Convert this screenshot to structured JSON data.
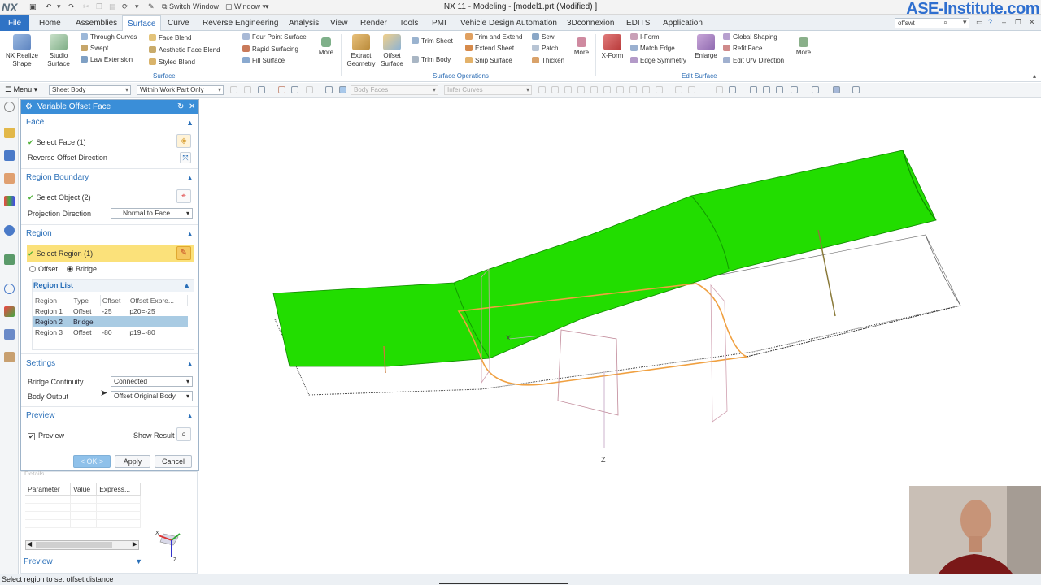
{
  "titlebar": {
    "logo": "NX",
    "switch_window": "Switch Window",
    "window_menu": "Window ▾",
    "title": "NX 11 - Modeling - [model1.prt (Modified) ]",
    "brand": "ASE-Institute.com"
  },
  "menubar": {
    "file": "File",
    "items": [
      "Home",
      "Assemblies",
      "Surface",
      "Curve",
      "Reverse Engineering",
      "Analysis",
      "View",
      "Render",
      "Tools",
      "PMI",
      "Vehicle Design Automation",
      "3Dconnexion",
      "EDITS",
      "Application"
    ],
    "active": "Surface",
    "search_value": "offswt"
  },
  "ribbon": {
    "nx_realize_shape": "NX Realize Shape",
    "studio_surface": "Studio Surface",
    "through_curves": "Through Curves",
    "swept": "Swept",
    "law_extension": "Law Extension",
    "face_blend": "Face Blend",
    "aesthetic_face_blend": "Aesthetic Face Blend",
    "styled_blend": "Styled Blend",
    "four_point_surface": "Four Point Surface",
    "rapid_surfacing": "Rapid Surfacing",
    "fill_surface": "Fill Surface",
    "more1": "More",
    "surface_group": "Surface",
    "extract_geometry": "Extract Geometry",
    "offset_surface": "Offset Surface",
    "trim_sheet": "Trim Sheet",
    "trim_body": "Trim Body",
    "trim_and_extend": "Trim and Extend",
    "extend_sheet": "Extend Sheet",
    "snip_surface": "Snip Surface",
    "sew": "Sew",
    "patch": "Patch",
    "thicken": "Thicken",
    "more2": "More",
    "surface_operations_group": "Surface Operations",
    "x_form": "X-Form",
    "i_form": "I-Form",
    "match_edge": "Match Edge",
    "edge_symmetry": "Edge Symmetry",
    "enlarge": "Enlarge",
    "global_shaping": "Global Shaping",
    "refit_face": "Refit Face",
    "edit_uv_direction": "Edit U/V Direction",
    "more3": "More",
    "edit_surface_group": "Edit Surface"
  },
  "selbar": {
    "menu": "Menu",
    "filter": "Sheet Body",
    "scope": "Within Work Part Only",
    "face_rule": "Body Faces",
    "curve_rule": "Infer Curves"
  },
  "dialog": {
    "title": "Variable Offset Face",
    "face": {
      "header": "Face",
      "select_face": "Select Face (1)",
      "reverse": "Reverse Offset Direction"
    },
    "region_boundary": {
      "header": "Region Boundary",
      "select_object": "Select Object (2)",
      "projection_label": "Projection Direction",
      "projection_value": "Normal to Face"
    },
    "region": {
      "header": "Region",
      "select_region": "Select Region (1)",
      "offset_option": "Offset",
      "bridge_option": "Bridge",
      "selected_option": "Bridge",
      "list_header": "Region List",
      "columns": [
        "Region",
        "Type",
        "Offset",
        "Offset Expre..."
      ],
      "rows": [
        [
          "Region 1",
          "Offset",
          "-25",
          "p20=-25"
        ],
        [
          "Region 2",
          "Bridge",
          "",
          ""
        ],
        [
          "Region 3",
          "Offset",
          "-80",
          "p19=-80"
        ]
      ],
      "selected_row": 1
    },
    "settings": {
      "header": "Settings",
      "bridge_continuity_label": "Bridge Continuity",
      "bridge_continuity_value": "Connected",
      "body_output_label": "Body Output",
      "body_output_value": "Offset Original Body"
    },
    "preview": {
      "header": "Preview",
      "preview_label": "Preview",
      "preview_checked": true,
      "show_result": "Show Result"
    },
    "buttons": {
      "ok": "< OK >",
      "apply": "Apply",
      "cancel": "Cancel"
    }
  },
  "details_panel": {
    "header": "Details",
    "columns": [
      "Parameter",
      "Value",
      "Express..."
    ],
    "preview_label": "Preview"
  },
  "graphics": {
    "axis_x": "X",
    "axis_z": "Z",
    "triad_x": "X",
    "triad_z": "Z"
  },
  "status": {
    "message": "Select region to set offset distance"
  },
  "colors": {
    "surface_green": "#22dd00",
    "curve_orange": "#f0a040",
    "accent_blue": "#3a8ed8",
    "brand_blue": "#2f6fcf"
  }
}
